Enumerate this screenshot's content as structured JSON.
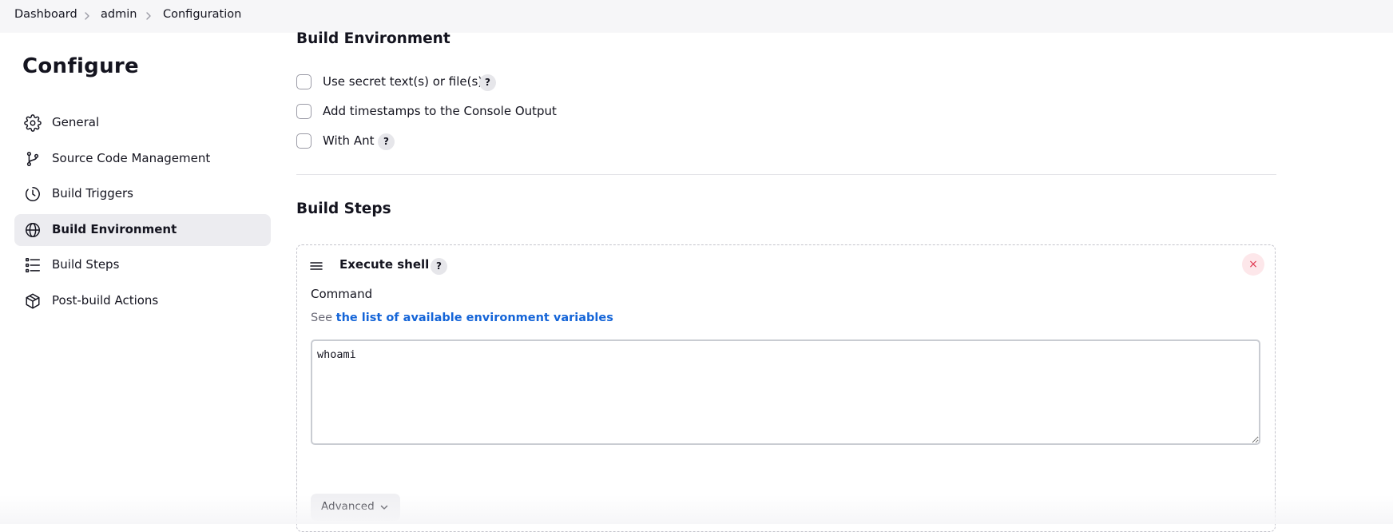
{
  "breadcrumb": {
    "items": [
      {
        "label": "Dashboard"
      },
      {
        "label": "admin"
      },
      {
        "label": "Configuration"
      }
    ]
  },
  "sidebar": {
    "title": "Configure",
    "items": [
      {
        "label": "General",
        "icon": "gear-icon"
      },
      {
        "label": "Source Code Management",
        "icon": "git-branch-icon"
      },
      {
        "label": "Build Triggers",
        "icon": "clock-icon"
      },
      {
        "label": "Build Environment",
        "icon": "globe-icon",
        "active": true
      },
      {
        "label": "Build Steps",
        "icon": "list-icon"
      },
      {
        "label": "Post-build Actions",
        "icon": "package-icon"
      }
    ]
  },
  "build_environment": {
    "title": "Build Environment",
    "options": [
      {
        "label": "Use secret text(s) or file(s)",
        "checked": false,
        "help": "?"
      },
      {
        "label": "Add timestamps to the Console Output",
        "checked": false
      },
      {
        "label": "With Ant",
        "checked": false,
        "help": "?"
      }
    ]
  },
  "build_steps": {
    "title": "Build Steps",
    "step": {
      "title": "Execute shell",
      "help": "?",
      "close_symbol": "×",
      "command_label": "Command",
      "see_prefix": "See",
      "env_link": "the list of available environment variables",
      "command_value": "whoami",
      "advanced_label": "Advanced"
    }
  },
  "colors": {
    "link": "#1565d8",
    "close": "#e0364f",
    "active_nav": "#ececf0"
  }
}
